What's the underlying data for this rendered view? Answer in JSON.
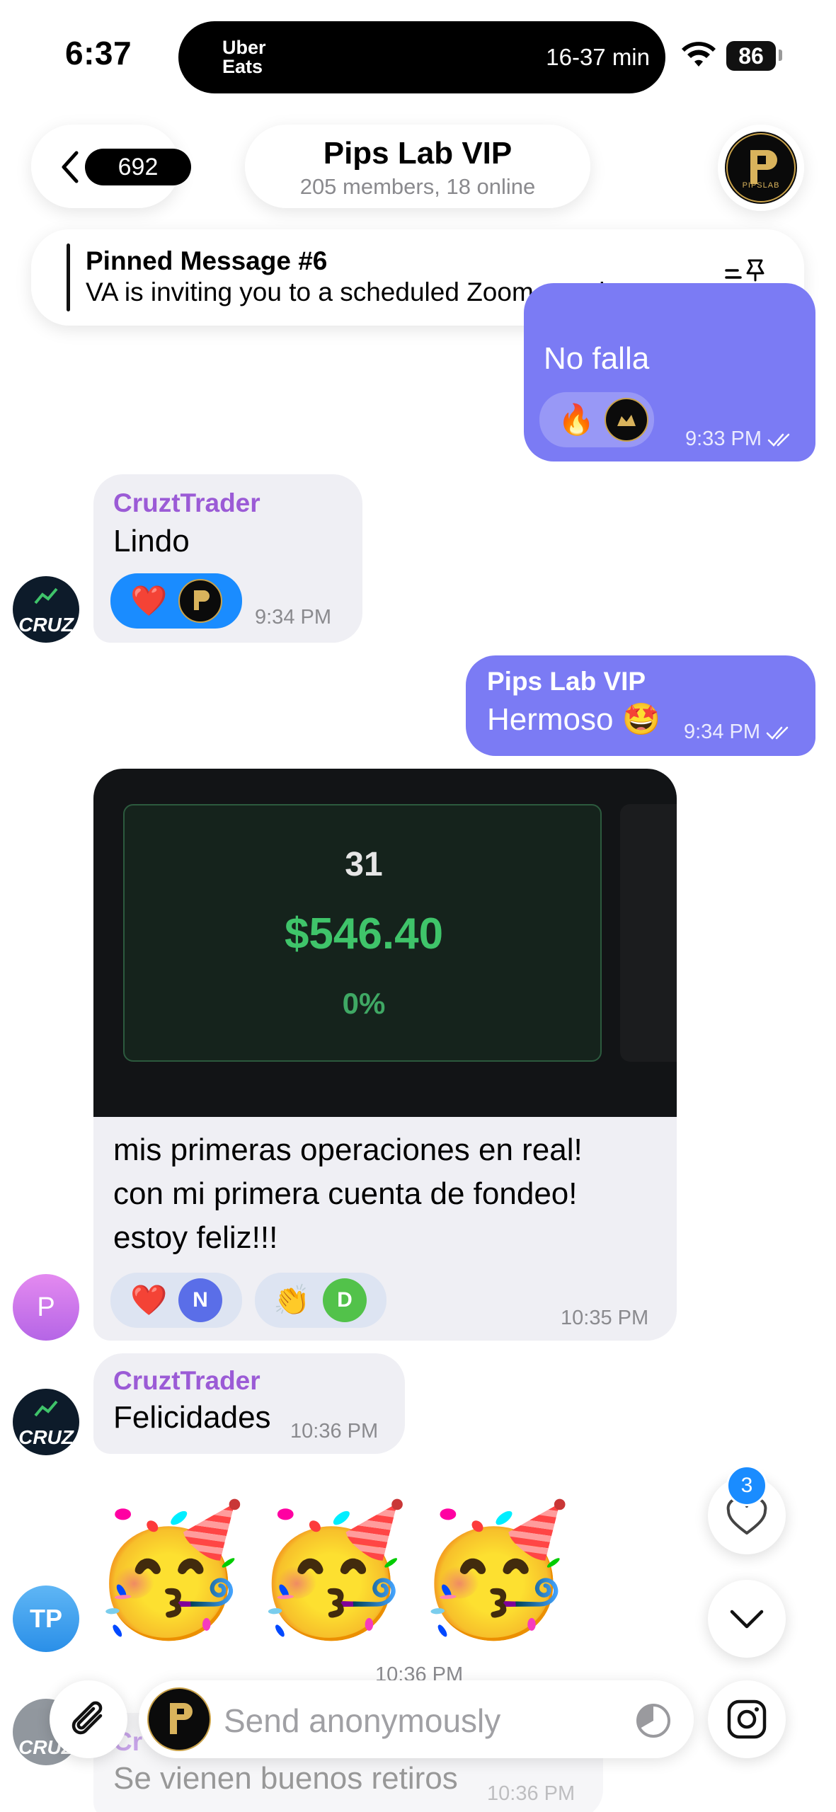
{
  "status_bar": {
    "time": "6:37",
    "island_app": "Uber Eats",
    "island_eta": "16-37 min",
    "battery": "86"
  },
  "header": {
    "back_count": "692",
    "title": "Pips Lab VIP",
    "subtitle": "205 members, 18 online",
    "avatar_label": "PIPSLAB"
  },
  "pinned": {
    "title": "Pinned Message #6",
    "text": "VA is inviting you to a scheduled Zoom meetin..."
  },
  "messages": [
    {
      "text": "No falla",
      "time": "9:33 PM",
      "reactions": [
        "🔥"
      ]
    },
    {
      "sender": "CruztTrader",
      "text": "Lindo",
      "time": "9:34 PM",
      "reactions": [
        "❤️"
      ],
      "avatar": "CRUZ"
    },
    {
      "sender": "Pips Lab VIP",
      "text": "Hermoso 🤩",
      "time": "9:34 PM"
    },
    {
      "image": {
        "day": "31",
        "amount": "$546.40",
        "percent": "0%"
      },
      "text_lines": [
        "mis primeras operaciones en real!",
        "con mi primera cuenta de fondeo!",
        "estoy feliz!!!"
      ],
      "time": "10:35 PM",
      "avatar": "P",
      "reactions": [
        {
          "emoji": "❤️",
          "user": "N"
        },
        {
          "emoji": "👏",
          "user": "D"
        }
      ]
    },
    {
      "sender": "CruztTrader",
      "text": "Felicidades",
      "time": "10:36 PM",
      "avatar": "CRUZ"
    },
    {
      "emoji": "🥳🥳🥳",
      "time": "10:36 PM",
      "avatar": "TP"
    },
    {
      "sender": "Cr",
      "text": "Se vienen buenos retiros",
      "time": "10:36 PM"
    }
  ],
  "reaction_fab_count": "3",
  "composer": {
    "placeholder": "Send anonymously"
  },
  "colors": {
    "outgoing": "#7b7bf4",
    "incoming": "#efeff4",
    "sender": "#9b5bd6",
    "reaction_selected": "#1a8cff"
  }
}
